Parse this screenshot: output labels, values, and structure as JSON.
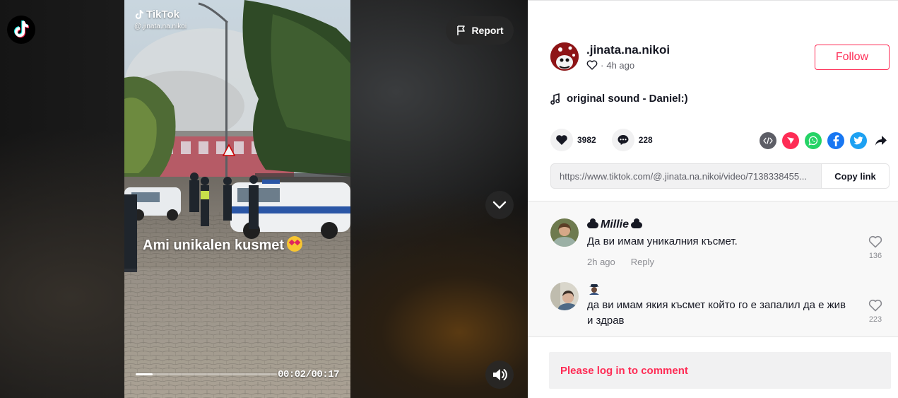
{
  "watermark": {
    "brand": "TikTok",
    "handle": "@.jinata.na.nikoi"
  },
  "video": {
    "caption": "Ami unikalen kusmet",
    "caption_emoji": "heart-eyes-emoji",
    "time": "00:02/00:17",
    "progress_fraction": 0.12
  },
  "controls": {
    "report_label": "Report"
  },
  "author": {
    "name": ".jinata.na.nikoi",
    "time": "4h ago",
    "follow_label": "Follow"
  },
  "music": {
    "title": "original sound - Daniel:)"
  },
  "stats": {
    "likes": "3982",
    "comments": "228"
  },
  "share_icons": [
    "embed-icon",
    "send-icon",
    "whatsapp-icon",
    "facebook-icon",
    "twitter-icon",
    "share-arrow-icon"
  ],
  "copy": {
    "url": "https://www.tiktok.com/@.jinata.na.nikoi/video/7138338455...",
    "button": "Copy link"
  },
  "comments": [
    {
      "name": "Millie",
      "text": "Да ви имам уникалния късмет.",
      "time": "2h ago",
      "reply": "Reply",
      "likes": "136"
    },
    {
      "name": "",
      "text": "да ви имам якия късмет който го е запалил да е жив и здрав",
      "likes": "223"
    }
  ],
  "login": {
    "label": "Please log in to comment"
  },
  "colors": {
    "accent": "#fe2c55",
    "text": "#161823",
    "muted": "#8a8b91"
  }
}
